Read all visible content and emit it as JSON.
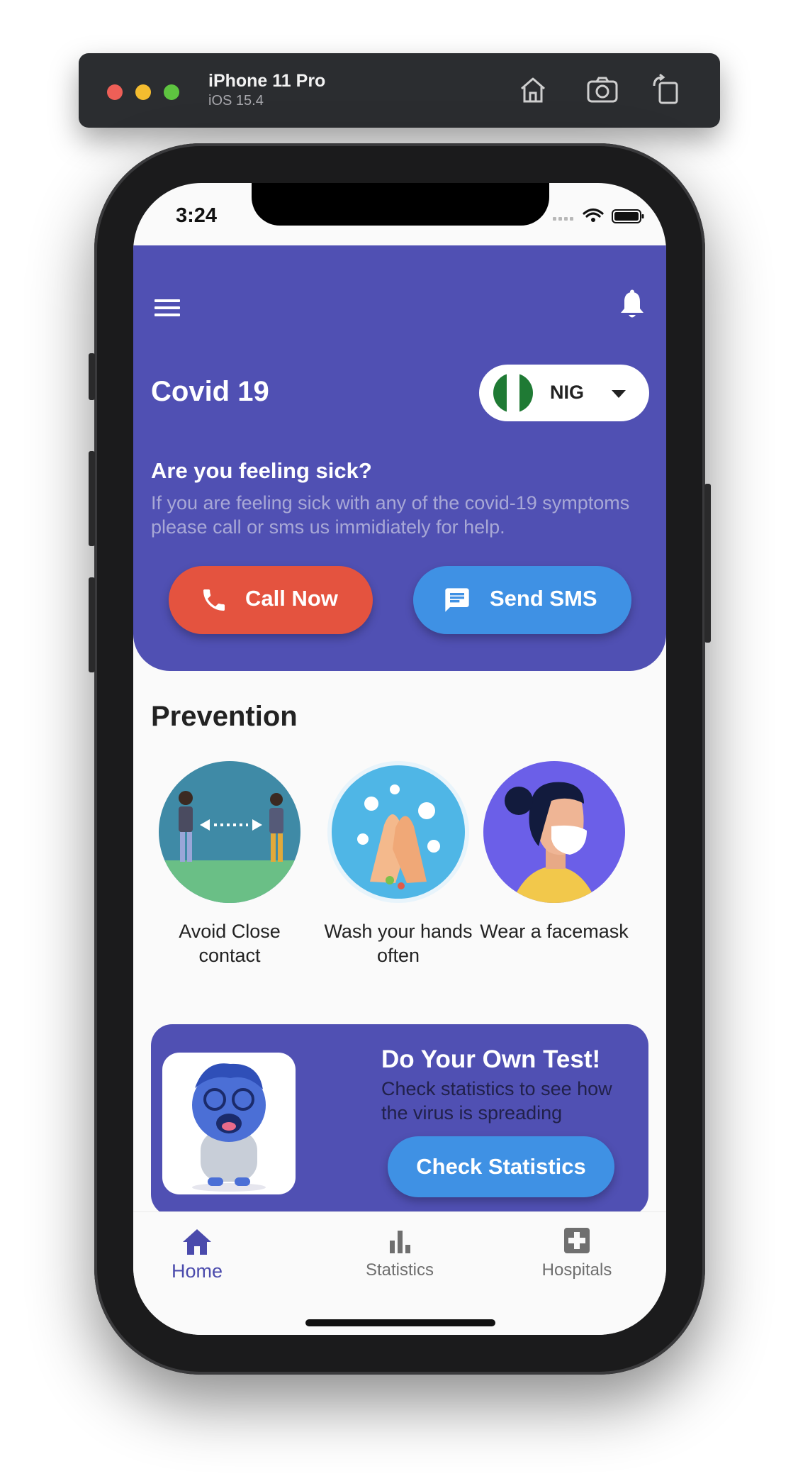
{
  "simulator": {
    "device": "iPhone 11 Pro",
    "os": "iOS 15.4"
  },
  "status_bar": {
    "time": "3:24"
  },
  "header": {
    "title": "Covid 19",
    "country_code": "NIG",
    "sick_title": "Are you feeling sick?",
    "sick_text": "If you are feeling sick with any of the covid-19 symptoms please call or sms us immidiately for help.",
    "call_label": "Call Now",
    "sms_label": "Send SMS"
  },
  "prevention": {
    "title": "Prevention",
    "items": [
      {
        "label": "Avoid Close contact",
        "icon": "social-distance-icon"
      },
      {
        "label": "Wash your hands often",
        "icon": "hand-washing-icon"
      },
      {
        "label": "Wear a facemask",
        "icon": "facemask-icon"
      }
    ]
  },
  "test_card": {
    "title": "Do Your Own Test!",
    "text": "Check statistics to see how the virus is spreading",
    "button_label": "Check Statistics"
  },
  "bottom_nav": {
    "items": [
      {
        "label": "Home",
        "icon": "home-icon",
        "active": true
      },
      {
        "label": "Statistics",
        "icon": "bar-chart-icon",
        "active": false
      },
      {
        "label": "Hospitals",
        "icon": "medical-cross-icon",
        "active": false
      }
    ]
  },
  "colors": {
    "primary": "#5050b3",
    "call": "#e4533f",
    "sms": "#3f91e4",
    "background": "#fafafa"
  }
}
